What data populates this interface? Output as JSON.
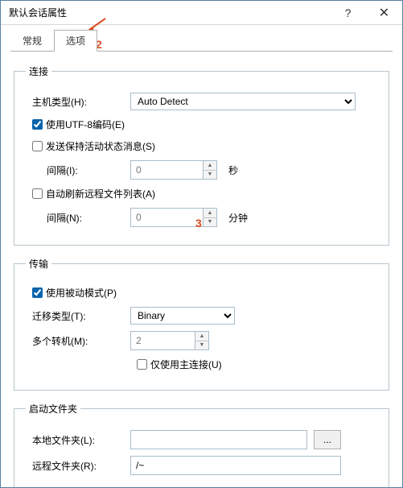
{
  "titlebar": {
    "title": "默认会话属性",
    "help": "?",
    "close": "✕"
  },
  "tabs": {
    "general": "常规",
    "options": "选项"
  },
  "annotations": {
    "two": "2",
    "three": "3"
  },
  "connection": {
    "legend": "连接",
    "host_type_label": "主机类型(H):",
    "host_type_value": "Auto Detect",
    "use_utf8_label": "使用UTF-8编码(E)",
    "keepalive_label": "发送保持活动状态消息(S)",
    "interval_i_label": "间隔(I):",
    "interval_i_value": "0",
    "interval_i_unit": "秒",
    "auto_refresh_label": "自动刷新远程文件列表(A)",
    "interval_n_label": "间隔(N):",
    "interval_n_value": "0",
    "interval_n_unit": "分钟"
  },
  "transfer": {
    "legend": "传输",
    "passive_label": "使用被动模式(P)",
    "transfer_type_label": "迁移类型(T):",
    "transfer_type_value": "Binary",
    "relays_label": "多个转机(M):",
    "relays_value": "2",
    "main_conn_only_label": "仅使用主连接(U)"
  },
  "startup": {
    "legend": "启动文件夹",
    "local_folder_label": "本地文件夹(L):",
    "local_folder_value": "",
    "browse": "...",
    "remote_folder_label": "远程文件夹(R):",
    "remote_folder_value": "/~"
  }
}
